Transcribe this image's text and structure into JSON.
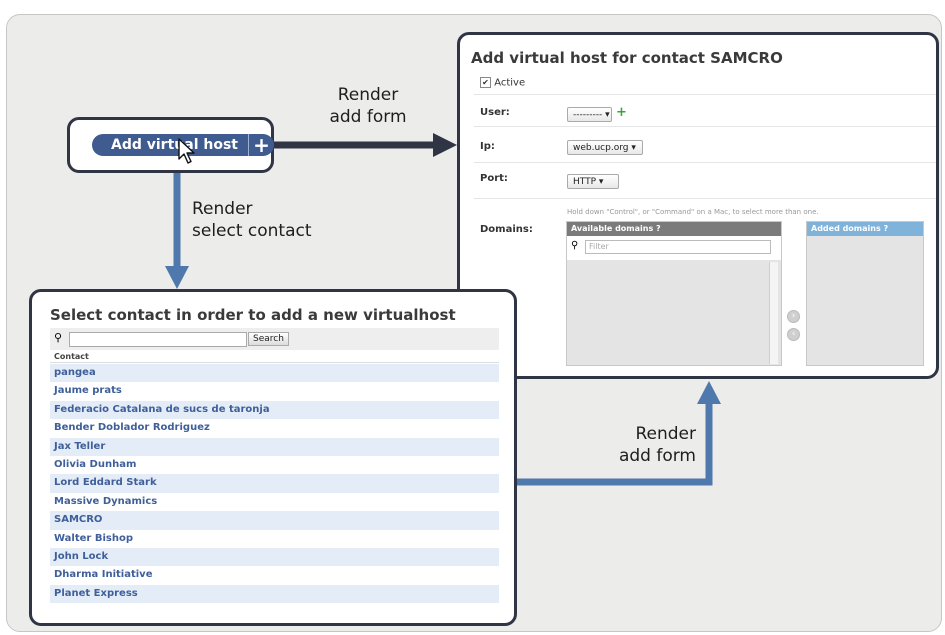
{
  "edge_labels": {
    "top_line1": "Render",
    "top_line2": "add form",
    "left_line1": "Render",
    "left_line2": "select contact",
    "bottom_line1": "Render",
    "bottom_line2": "add form"
  },
  "button_panel": {
    "label": "Add virtual host",
    "plus": "+"
  },
  "add_form": {
    "title": "Add virtual host for contact SAMCRO",
    "active_label": "Active",
    "user_label": "User:",
    "user_value": "---------",
    "ip_label": "Ip:",
    "ip_value": "web.ucp.org",
    "port_label": "Port:",
    "port_value": "HTTP",
    "domains_label": "Domains:",
    "domains_help": "Hold down \"Control\", or \"Command\" on a Mac, to select more than one.",
    "available_header": "Available domains",
    "filter_placeholder": "Filter",
    "added_header": "Added domains"
  },
  "select_contact": {
    "title": "Select contact in order to add a new virtualhost",
    "search_button": "Search",
    "column_header": "Contact",
    "contacts": [
      "pangea",
      "Jaume prats",
      "Federacio Catalana de sucs de taronja",
      "Bender Doblador Rodriguez",
      "Jax Teller",
      "Olivia Dunham",
      "Lord Eddard Stark",
      "Massive Dynamics",
      "SAMCRO",
      "Walter Bishop",
      "John Lock",
      "Dharma Initiative",
      "Planet Express"
    ]
  },
  "colors": {
    "panel_border": "#2f3545",
    "arrow_blue": "#4f78ad",
    "button_blue": "#3f5b8f"
  }
}
